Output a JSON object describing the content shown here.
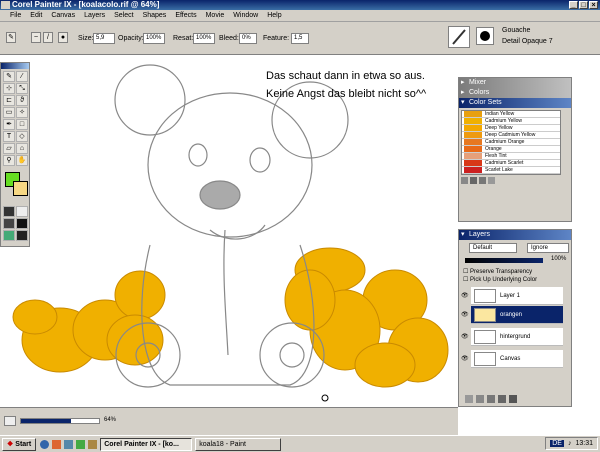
{
  "window": {
    "title": "Corel Painter IX - [koalacolo.rif @ 64%]"
  },
  "menu": [
    "File",
    "Edit",
    "Canvas",
    "Layers",
    "Select",
    "Shapes",
    "Effects",
    "Movie",
    "Window",
    "Help"
  ],
  "options": {
    "size_label": "Size:",
    "size": "5,9",
    "opacity_label": "Opacity:",
    "opacity": "100%",
    "resat_label": "Resat:",
    "resat": "100%",
    "bleed_label": "Bleed:",
    "bleed": "0%",
    "feature_label": "Feature:",
    "feature": "1,5"
  },
  "brush": {
    "category": "Gouache",
    "variant": "Detail Opaque 7"
  },
  "note": {
    "line1": "Das schaut dann in etwa so aus.",
    "line2": "Keine Angst das bleibt nicht so^^"
  },
  "panels": {
    "mixer": "Mixer",
    "colors": "Colors",
    "color_sets": "Color Sets",
    "layers": "Layers"
  },
  "color_sets": [
    {
      "name": "Indian Yellow",
      "color": "#e8a010"
    },
    {
      "name": "Cadmium Yellow",
      "color": "#f0b000"
    },
    {
      "name": "Deep Yellow",
      "color": "#f3a800"
    },
    {
      "name": "Deep Cadmium Yellow",
      "color": "#ee9a10"
    },
    {
      "name": "Cadmium Orange",
      "color": "#e77820"
    },
    {
      "name": "Orange",
      "color": "#e86a18"
    },
    {
      "name": "Flesh Tint",
      "color": "#e6a07a"
    },
    {
      "name": "Cadmium Scarlet",
      "color": "#d83818"
    },
    {
      "name": "Scarlet Lake",
      "color": "#cc2020"
    }
  ],
  "layers_panel": {
    "composite": "Default",
    "depth": "Ignore",
    "opacity": "100%",
    "preserve_transparency": "Preserve Transparency",
    "pick_up_underlying": "Pick Up Underlying Color",
    "items": [
      "Layer 1",
      "orangen",
      "hintergrund",
      "Canvas"
    ],
    "selected": "orangen"
  },
  "status": {
    "zoom": "64%"
  },
  "taskbar": {
    "start": "Start",
    "buttons": [
      "Corel Painter IX - [ko...",
      "koala18 - Paint"
    ],
    "lang": "DE",
    "time": "13:31"
  },
  "colors": {
    "titlebar": "#0a246a",
    "primary": "#66dd22",
    "secondary": "#f7d884",
    "orange": "#f0b000"
  }
}
